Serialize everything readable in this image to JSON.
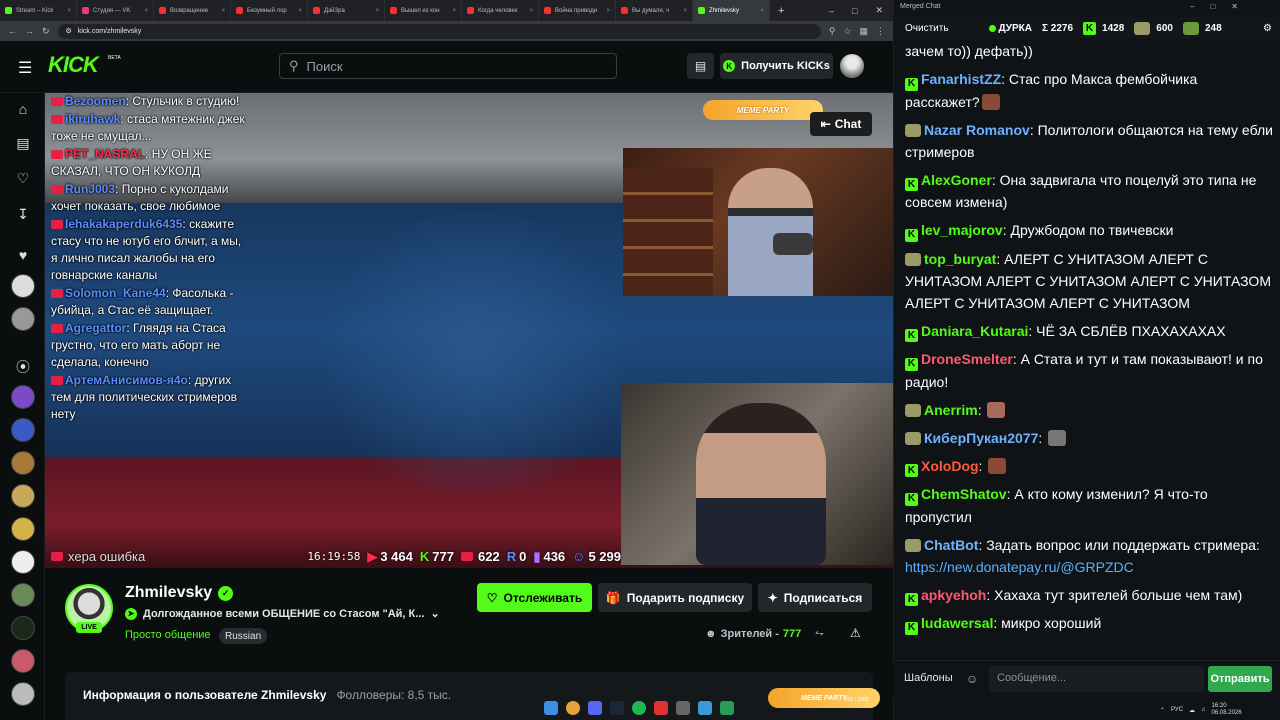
{
  "browser": {
    "tabs": [
      {
        "label": "Stream – Kick",
        "color": "#53fc18"
      },
      {
        "label": "Студия — VK",
        "color": "#e03e7e"
      },
      {
        "label": "Возвращение",
        "color": "#ff2d2d"
      },
      {
        "label": "Безумный лор",
        "color": "#ff2d2d"
      },
      {
        "label": "ДэйЗра",
        "color": "#ff2d2d"
      },
      {
        "label": "Вышел из кон",
        "color": "#ff2d2d"
      },
      {
        "label": "Когда человек",
        "color": "#ff2d2d"
      },
      {
        "label": "Война приводи",
        "color": "#ff2d2d"
      },
      {
        "label": "Вы думали, ч",
        "color": "#ff2d2d"
      },
      {
        "label": "Zhmilevsky",
        "color": "#53fc18",
        "active": true
      }
    ],
    "url": "kick.com/zhmilevsky"
  },
  "header": {
    "logo": "KICK",
    "beta": "BETA",
    "search_placeholder": "Поиск",
    "get_kicks": "Получить KICKs"
  },
  "video": {
    "meme_party": "MEME PARTY",
    "chat_button": "Chat",
    "overlay_chat": [
      {
        "name": "Bezoomen",
        "text": "Стульчик в студию!",
        "color": "#5b8cff"
      },
      {
        "name": "ikiruhawk",
        "text": "стаса мятежник джек тоже не смущал...",
        "color": "#5b8cff"
      },
      {
        "name": "PET_NASRAL",
        "text": "НУ ОН ЖЕ СКАЗАЛ, ЧТО ОН КУКОЛД",
        "color": "#ff2d4b"
      },
      {
        "name": "RunJ003",
        "text": "Порно с куколдами хочет показать, свое любимое",
        "color": "#5b8cff"
      },
      {
        "name": "lehakakaperduk6435",
        "text": "скажите стасу что не ютуб его блчит, а мы, я лично писал жалобы на его говнарские каналы",
        "color": "#5b8cff"
      },
      {
        "name": "Solomon_Kane44",
        "text": "Фасолька - убийца, а Стас её защищает.",
        "color": "#5b8cff"
      },
      {
        "name": "Agregattor",
        "text": "Гляядя на Стаса грустно, что его мать аборт не сделала, конечно",
        "color": "#5b8cff"
      },
      {
        "name": "АртемАнисимов-я4о",
        "text": "других тем для политических стримеров нету",
        "color": "#5b8cff"
      }
    ],
    "stats": {
      "partial": "херa ошибка",
      "time": "16:19:58",
      "youtube": "3 464",
      "kick": "777",
      "vk": "622",
      "r": "0",
      "twitch": "436",
      "viewers": "5 299"
    }
  },
  "channel": {
    "name": "Zhmilevsky",
    "live": "LIVE",
    "title": "Долгожданное всеми ОБЩЕНИЕ со Стасом \"Ай, К...",
    "category": "Просто общение",
    "language": "Russian",
    "follow": "Отслеживать",
    "gift_sub": "Подарить подписку",
    "subscribe": "Подписаться",
    "viewers_label": "Зрителей -",
    "viewers_count": "777",
    "about_title": "Информация о пользователе Zhmilevsky",
    "about_followers": "Фолловеры: 8,5 тыс."
  },
  "right_chat": {
    "window_title": "Merged Chat",
    "clear": "Очистить",
    "channel": "ДУРКА",
    "total": "Σ 2276",
    "kick": "1428",
    "twitch": "600",
    "other": "248",
    "messages": [
      {
        "name": "",
        "text": "зачем то)) дефать))",
        "color": "#fff",
        "src": "none"
      },
      {
        "name": "FanarhistZZ",
        "text": "Стас про Макса фембойчика расскажет?",
        "color": "#6db1ff",
        "src": "kick",
        "emote": "#8a4a3a"
      },
      {
        "name": "Nazar Romanov",
        "text": "Политологи общаются на тему ебли стримеров",
        "color": "#6db1ff",
        "src": "tw"
      },
      {
        "name": "AlexGoner",
        "text": "Она задвигала что поцелуй это типа не совсем измена)",
        "color": "#53fc18",
        "src": "kick"
      },
      {
        "name": "lev_majorov",
        "text": "Дружбодом по твичевски",
        "color": "#53fc18",
        "src": "kick"
      },
      {
        "name": "top_buryat",
        "text": "АЛЕРТ С УНИТАЗОМ АЛЕРТ С УНИТАЗОМ АЛЕРТ С УНИТАЗОМ АЛЕРТ С УНИТАЗОМ АЛЕРТ С УНИТАЗОМ АЛЕРТ С УНИТАЗОМ",
        "color": "#53fc18",
        "src": "tw"
      },
      {
        "name": "Daniara_Kutarai",
        "text": "ЧЁ ЗА СБЛЁВ ПХАХАХАХАХ",
        "color": "#53fc18",
        "src": "kick"
      },
      {
        "name": "DroneSmelter",
        "text": "А Стата и тут и там показывают! и по радио!",
        "color": "#ff5a6e",
        "src": "kick"
      },
      {
        "name": "Anerrim",
        "text": "",
        "color": "#53fc18",
        "src": "tw",
        "emote": "#a86a5a"
      },
      {
        "name": "КиберПукан2077",
        "text": "",
        "color": "#6db1ff",
        "src": "tw",
        "emote": "#777"
      },
      {
        "name": "XoloDog",
        "text": "",
        "color": "#ff5a3c",
        "src": "kick",
        "emote": "#8a4a3a"
      },
      {
        "name": "ChemShatov",
        "text": "А кто кому изменил? Я что-то пропустил",
        "color": "#53fc18",
        "src": "kick"
      },
      {
        "name": "ChatBot",
        "text": "Задать вопрос или поддержать стримера:",
        "link": "https://new.donatepay.ru/@GRPZDC",
        "color": "#6db1ff",
        "src": "tw"
      },
      {
        "name": "apkyehoh",
        "text": "Хахаха тут зрителей больше чем там)",
        "color": "#ff5a6e",
        "src": "kick"
      },
      {
        "name": "ludawersal",
        "text": "микро хороший",
        "color": "#53fc18",
        "src": "kick"
      }
    ],
    "templates": "Шаблоны",
    "message_placeholder": "Сообщение...",
    "send": "Отправить"
  },
  "overlay": {
    "meme": "MEME PARTY",
    "progress": "200 / 1500"
  },
  "tray": {
    "lang": "РУС",
    "time": "16:20",
    "date": "06.08.2026"
  }
}
